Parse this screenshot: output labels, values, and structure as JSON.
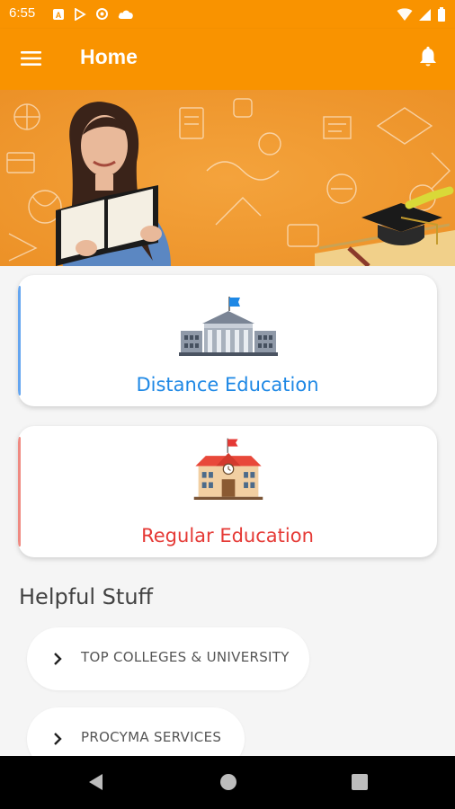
{
  "status_bar": {
    "time": "6:55"
  },
  "app_bar": {
    "title": "Home",
    "menu_icon": "hamburger-menu-icon",
    "notification_icon": "bell-icon",
    "color": "#f99300"
  },
  "cards": [
    {
      "label": "Distance Education",
      "icon": "university-building-icon",
      "label_color": "#1e88e5",
      "accent_color": "#64a5f0"
    },
    {
      "label": "Regular Education",
      "icon": "school-building-icon",
      "label_color": "#e53935",
      "accent_color": "#ef8a82"
    }
  ],
  "helpful_stuff": {
    "title": "Helpful Stuff",
    "items": [
      {
        "label": "TOP COLLEGES & UNIVERSITY",
        "icon": "chevron-right-icon"
      },
      {
        "label": "PROCYMA SERVICES",
        "icon": "chevron-right-icon"
      }
    ]
  },
  "nav_bar": {
    "buttons": [
      "back-icon",
      "home-icon",
      "recents-icon"
    ]
  }
}
